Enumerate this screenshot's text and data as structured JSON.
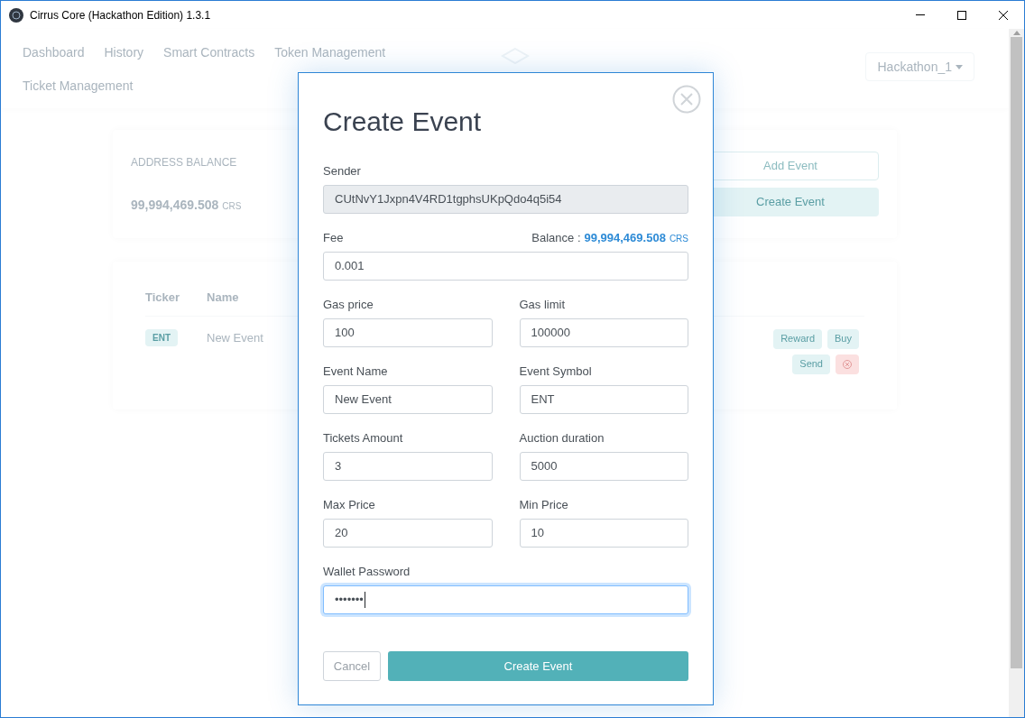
{
  "window": {
    "title": "Cirrus Core (Hackathon Edition) 1.3.1"
  },
  "nav": {
    "items": [
      "Dashboard",
      "History",
      "Smart Contracts",
      "Token Management",
      "Ticket Management"
    ]
  },
  "wallet_menu": {
    "label": "Hackathon_1"
  },
  "balance_card": {
    "title": "ADDRESS BALANCE",
    "amount": "99,994,469.508",
    "unit": "CRS",
    "buttons": [
      {
        "label": "Add Event",
        "kind": "outline"
      },
      {
        "label": "Create Event",
        "kind": "solid"
      }
    ]
  },
  "tickets_table": {
    "columns": [
      "Ticker",
      "Name"
    ],
    "rows": [
      {
        "ticker": "ENT",
        "name": "New Event",
        "actions": [
          {
            "label": "Reward",
            "kind": "teal"
          },
          {
            "label": "Buy",
            "kind": "teal"
          },
          {
            "label": "Send",
            "kind": "teal"
          },
          {
            "kind": "danger"
          }
        ]
      }
    ]
  },
  "dialog": {
    "title": "Create Event",
    "rows": [
      [
        {
          "label": "Sender",
          "value": "CUtNvY1Jxpn4V4RD1tgphsUKpQdo4q5i54",
          "disabled": true,
          "focused": false
        }
      ],
      [
        {
          "label": "Fee",
          "value": "0.001",
          "disabled": false,
          "focused": false,
          "balance": {
            "label": "Balance :",
            "amount": "99,994,469.508",
            "unit": "CRS"
          }
        }
      ],
      [
        {
          "label": "Gas price",
          "value": "100",
          "disabled": false,
          "focused": false
        },
        {
          "label": "Gas limit",
          "value": "100000",
          "disabled": false,
          "focused": false
        }
      ],
      [
        {
          "label": "Event Name",
          "value": "New Event",
          "disabled": false,
          "focused": false
        },
        {
          "label": "Event Symbol",
          "value": "ENT",
          "disabled": false,
          "focused": false
        }
      ],
      [
        {
          "label": "Tickets Amount",
          "value": "3",
          "disabled": false,
          "focused": false
        },
        {
          "label": "Auction duration",
          "value": "5000",
          "disabled": false,
          "focused": false
        }
      ],
      [
        {
          "label": "Max Price",
          "value": "20",
          "disabled": false,
          "focused": false
        },
        {
          "label": "Min Price",
          "value": "10",
          "disabled": false,
          "focused": false
        }
      ],
      [
        {
          "label": "Wallet Password",
          "value": "•••••••",
          "disabled": false,
          "focused": true
        }
      ]
    ],
    "buttons": [
      {
        "label": "Cancel",
        "kind": "secondary"
      },
      {
        "label": "Create Event",
        "kind": "primary"
      }
    ]
  }
}
